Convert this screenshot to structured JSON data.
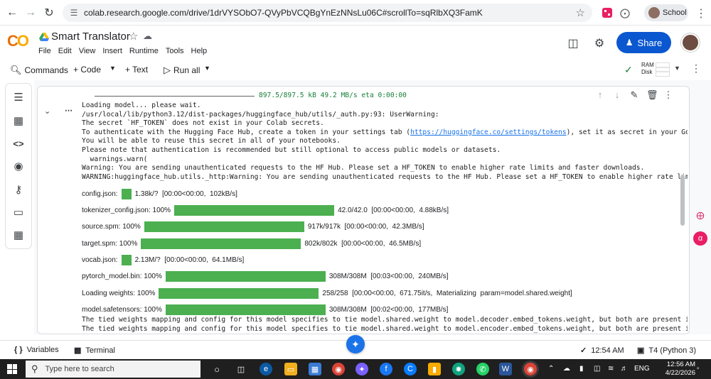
{
  "browser": {
    "url": "colab.research.google.com/drive/1drVYSObO7-QVyPbVCQBgYnEzNNsLu06C#scrollTo=sqRlbXQ3FamK",
    "profile_label": "School"
  },
  "notebook": {
    "title": "Smart Translator",
    "menu": [
      "File",
      "Edit",
      "View",
      "Insert",
      "Runtime",
      "Tools",
      "Help"
    ],
    "share_label": "Share"
  },
  "toolbar": {
    "commands_label": "Commands",
    "code_label": "+ Code",
    "text_label": "+ Text",
    "run_all_label": "Run all",
    "ram_label": "RAM",
    "disk_label": "Disk"
  },
  "output": {
    "top_progress_text": "897.5/897.5 kB 49.2 MB/s eta 0:00:00",
    "lines": [
      "Loading model... please wait.",
      "/usr/local/lib/python3.12/dist-packages/huggingface_hub/utils/_auth.py:93: UserWarning:",
      "The secret `HF_TOKEN` does not exist in your Colab secrets.",
      "To authenticate with the Hugging Face Hub, create a token in your settings tab (",
      "You will be able to reuse this secret in all of your notebooks.",
      "Please note that authentication is recommended but still optional to access public models or datasets.",
      "  warnings.warn(",
      "Warning: You are sending unauthenticated requests to the HF Hub. Please set a HF_TOKEN to enable higher rate limits and faster downloads.",
      "WARNING:huggingface_hub.utils._http:Warning: You are sending unauthenticated requests to the HF Hub. Please set a HF_TOKEN to enable higher rate limits"
    ],
    "token_link": "https://huggingface.co/settings/tokens",
    "token_line_suffix": "), set it as secret in your Googl",
    "progress_bars": [
      {
        "label": "config.json:",
        "pct": "",
        "fill": 0.03,
        "status": "1.38k/?  [00:00<00:00,  102kB/s]"
      },
      {
        "label": "tokenizer_config.json:",
        "pct": "100%",
        "fill": 1.0,
        "status": "42.0/42.0  [00:00<00:00,  4.88kB/s]"
      },
      {
        "label": "source.spm:",
        "pct": "100%",
        "fill": 1.0,
        "status": "917k/917k  [00:00<00:00,  42.3MB/s]"
      },
      {
        "label": "target.spm:",
        "pct": "100%",
        "fill": 1.0,
        "status": "802k/802k  [00:00<00:00,  46.5MB/s]"
      },
      {
        "label": "vocab.json:",
        "pct": "",
        "fill": 0.03,
        "status": "2.13M/?  [00:00<00:00,  64.1MB/s]"
      },
      {
        "label": "pytorch_model.bin:",
        "pct": "100%",
        "fill": 1.0,
        "status": "308M/308M  [00:03<00:00,  240MB/s]"
      },
      {
        "label": "Loading weights:",
        "pct": "100%",
        "fill": 1.0,
        "status": "258/258  [00:00<00:00,  671.75it/s,  Materializing  param=model.shared.weight]"
      },
      {
        "label": "model.safetensors:",
        "pct": "100%",
        "fill": 1.0,
        "status": "308M/308M  [00:02<00:00,  177MB/s]"
      }
    ],
    "tail_lines": [
      "The tied weights mapping and config for this model specifies to tie model.shared.weight to model.decoder.embed_tokens.weight, but both are present in t",
      "The tied weights mapping and config for this model specifies to tie model.shared.weight to model.encoder.embed_tokens.weight, but both are present in t"
    ]
  },
  "statusbar": {
    "variables_label": "Variables",
    "terminal_label": "Terminal",
    "time": "12:54 AM",
    "runtime": "T4 (Python 3)"
  },
  "taskbar": {
    "search_placeholder": "Type here to search",
    "language": "ENG",
    "clock_time": "12:56 AM",
    "clock_date": "4/22/2026"
  },
  "colors": {
    "share_blue": "#0b57d0",
    "progress_green": "#4caf50"
  }
}
